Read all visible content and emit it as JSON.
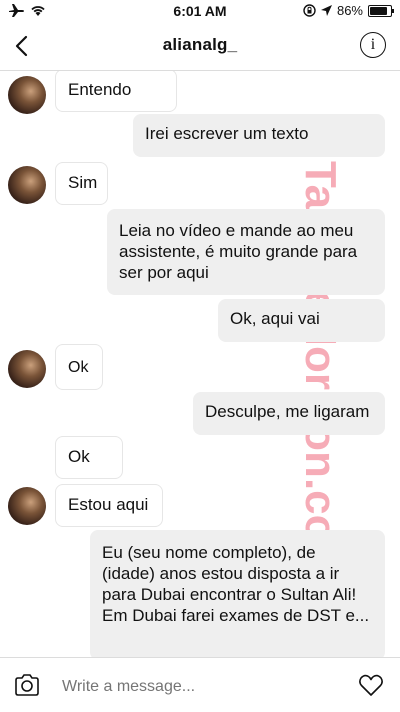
{
  "status_bar": {
    "time": "6:01 AM",
    "battery": "86%"
  },
  "header": {
    "title": "alianalg_"
  },
  "messages": [
    {
      "side": "in",
      "text": "Entendo"
    },
    {
      "side": "out",
      "text": "Irei escrever um texto"
    },
    {
      "side": "in",
      "text": "Sim"
    },
    {
      "side": "out",
      "text": "Leia no vídeo e mande ao meu assistente, é muito grande para ser por aqui"
    },
    {
      "side": "out",
      "text": "Ok, aqui vai"
    },
    {
      "side": "in",
      "text": "Ok"
    },
    {
      "side": "out",
      "text": "Desculpe, me ligaram"
    },
    {
      "side": "in",
      "text": "Ok"
    },
    {
      "side": "in",
      "text": "Estou aqui"
    },
    {
      "side": "out",
      "text": "Eu (seu nome completo), de (idade) anos estou disposta a ir para Dubai encontrar o Sultan Ali! Em Dubai farei exames de DST e..."
    }
  ],
  "watermark": "TagTheHorizon.com.br",
  "composer": {
    "placeholder": "Write a message..."
  },
  "icons": {
    "airplane": "airplane-icon",
    "wifi": "wifi-icon",
    "lock_rotation": "rotation-lock-icon",
    "location": "location-arrow-icon",
    "battery": "battery-icon",
    "back": "chevron-left-icon",
    "info": "info-icon",
    "camera": "camera-icon",
    "heart": "heart-icon"
  }
}
